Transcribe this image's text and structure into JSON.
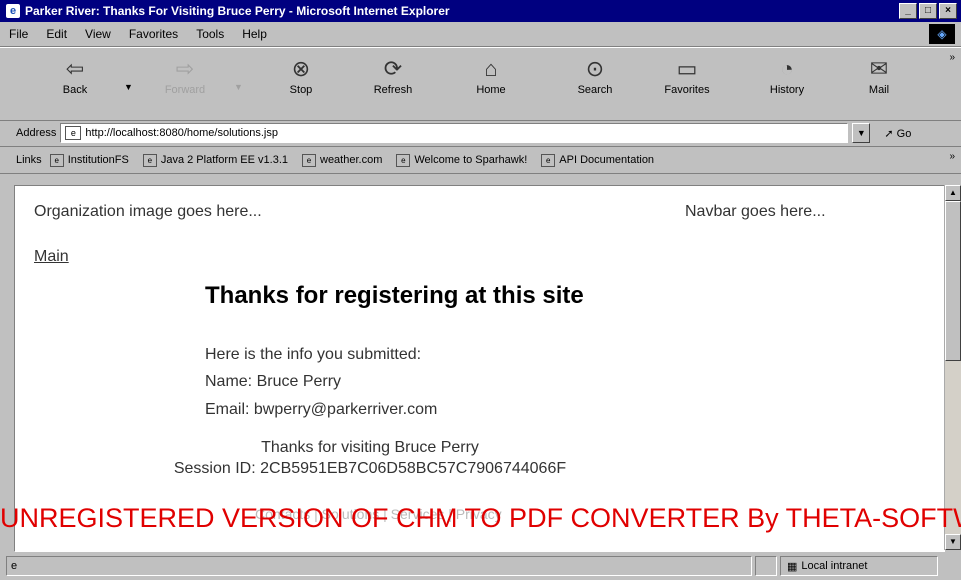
{
  "window": {
    "title": "Parker River: Thanks For Visiting Bruce Perry - Microsoft Internet Explorer",
    "icon": "ie-icon",
    "controls": [
      "_",
      "□",
      "×"
    ]
  },
  "menu": [
    "File",
    "Edit",
    "View",
    "Favorites",
    "Tools",
    "Help"
  ],
  "toolbar": {
    "back": "Back",
    "forward": "Forward",
    "stop": "Stop",
    "refresh": "Refresh",
    "home": "Home",
    "search": "Search",
    "favorites": "Favorites",
    "history": "History",
    "mail": "Mail",
    "more": "»"
  },
  "address": {
    "label": "Address",
    "url": "http://localhost:8080/home/solutions.jsp",
    "go": "Go"
  },
  "links": {
    "label": "Links",
    "items": [
      "InstitutionFS",
      "Java 2 Platform EE v1.3.1",
      "weather.com",
      "Welcome to Sparhawk!",
      "API Documentation"
    ]
  },
  "page": {
    "org_placeholder": "Organization image goes here...",
    "navbar_placeholder": "Navbar goes here...",
    "main_link": "Main",
    "heading": "Thanks for registering at this site",
    "info_intro": "Here is the info you submitted:",
    "name_line": "Name: Bruce Perry",
    "email_line": "Email: bwperry@parkerriver.com",
    "thanks_line": "Thanks for visiting Bruce Perry",
    "session_line": "Session ID: 2CB5951EB7C06D58BC57C7906744066F",
    "footer_links": "Contacts | Solutions | Services | Privacy"
  },
  "watermark": "UNREGISTERED VERSION OF CHM TO PDF CONVERTER By THETA-SOFTWARE",
  "status": {
    "zone": "Local intranet"
  }
}
